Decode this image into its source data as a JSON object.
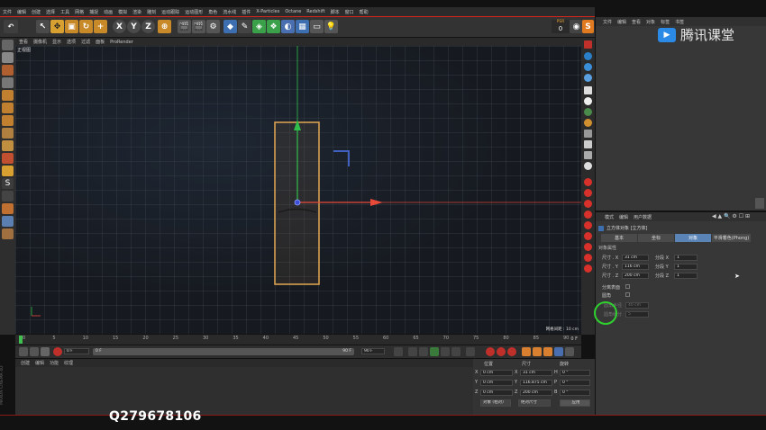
{
  "menubar": {
    "items": [
      "文件",
      "编辑",
      "创建",
      "选择",
      "工具",
      "网格",
      "捕捉",
      "动画",
      "模拟",
      "渲染",
      "雕刻",
      "运动跟踪",
      "运动图形",
      "角色",
      "流水线",
      "插件",
      "X-Particles",
      "Octane",
      "Redshift",
      "脚本",
      "窗口",
      "帮助"
    ]
  },
  "toolbar": {
    "axis_x": "X",
    "axis_y": "Y",
    "axis_z": "Z",
    "psr_label": "PSR",
    "psr_value": "0"
  },
  "viewport": {
    "menu": [
      "查看",
      "摄像机",
      "显示",
      "选项",
      "过滤",
      "面板",
      "ProRender"
    ],
    "label": "正视图",
    "grid_info": "网格间距 : 10 cm",
    "axis_colors": {
      "x": "#e84a3a",
      "y": "#2fbf4a",
      "object_outline": "#d8a050"
    }
  },
  "object_manager": {
    "menu": [
      "文件",
      "编辑",
      "查看",
      "对象",
      "标签",
      "书签"
    ]
  },
  "attribute_manager": {
    "menu": [
      "模式",
      "编辑",
      "用户数据"
    ],
    "object_title": "立方体对象 [立方体]",
    "tabs": [
      "基本",
      "坐标",
      "对象",
      "平滑着色(Phong)"
    ],
    "active_tab": "对象",
    "section": "对象属性",
    "size_x_label": "尺寸 . X",
    "size_x": "31 cm",
    "size_y_label": "尺寸 . Y",
    "size_y": "116 cm",
    "size_z_label": "尺寸 . Z",
    "size_z": "200 cm",
    "seg_x_label": "分段 X",
    "seg_x": "1",
    "seg_y_label": "分段 Y",
    "seg_y": "1",
    "seg_z_label": "分段 Z",
    "seg_z": "1",
    "separate_label": "分离表面",
    "fillet_label": "圆角",
    "fillet_radius_label": "圆角半径",
    "fillet_radius": "40 cm",
    "fillet_subdiv_label": "圆角细分",
    "fillet_subdiv": "5"
  },
  "timeline": {
    "ticks": [
      "0",
      "5",
      "10",
      "15",
      "20",
      "25",
      "30",
      "35",
      "40",
      "45",
      "50",
      "55",
      "60",
      "65",
      "70",
      "75",
      "80",
      "85",
      "90"
    ],
    "current_frame": "0 F"
  },
  "transport": {
    "start": "0 F",
    "mid": "0 F",
    "end": "90 F",
    "end2": "90 F"
  },
  "material_manager": {
    "menu": [
      "创建",
      "编辑",
      "功能",
      "纹理"
    ]
  },
  "coordinates": {
    "header_pos": "位置",
    "header_size": "尺寸",
    "header_rot": "旋转",
    "x_label": "X",
    "y_label": "Y",
    "z_label": "Z",
    "pos_x": "0 cm",
    "pos_y": "0 cm",
    "pos_z": "0 cm",
    "size_x": "31 cm",
    "size_y": "116.875 cm",
    "size_z": "200 cm",
    "h_label": "H",
    "p_label": "P",
    "b_label": "B",
    "rot_h": "0 °",
    "rot_p": "0 °",
    "rot_b": "0 °",
    "mode_object": "对象 (相对)",
    "mode_size": "绝对尺寸",
    "apply_button": "应用"
  },
  "branding": {
    "logo_text": "腾讯课堂",
    "contact": "Q279678106",
    "brand_color": "#2b8ae6"
  },
  "side_label": "MAXON CINEMA 4D",
  "colors": {
    "active_tab": "#5b84b6",
    "highlight_circle": "#2fd02f",
    "menubar_red_line": "#d9261c"
  }
}
